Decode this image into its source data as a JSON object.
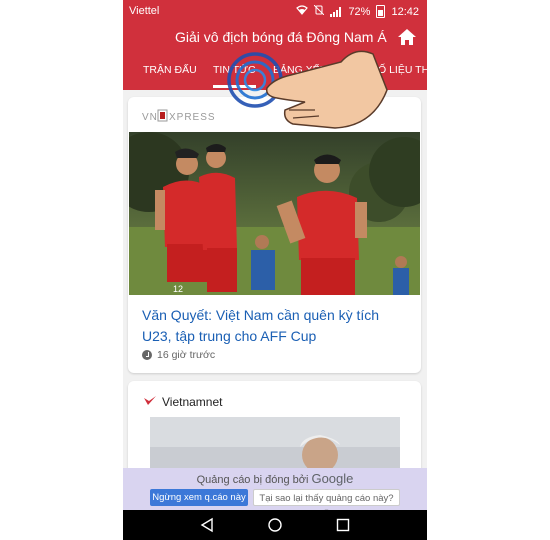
{
  "status_bar": {
    "carrier": "Viettel",
    "battery": "72%",
    "time": "12:42"
  },
  "app_bar": {
    "title": "Giải vô địch bóng đá Đông Nam Á",
    "home_icon": "home-icon"
  },
  "tabs": [
    {
      "label": "TRẬN ĐẤU",
      "active": false
    },
    {
      "label": "TIN TỨC",
      "active": true
    },
    {
      "label": "BẢNG XẾP HẠNG",
      "active": false
    },
    {
      "label": "SỐ LIỆU THỐNG KÊ",
      "active": false
    }
  ],
  "feed": {
    "card1": {
      "source": "VNEXPRESS",
      "headline": "Văn Quyết: Việt Nam cần quên kỳ tích U23, tập trung cho AFF Cup",
      "time": "16 giờ trước"
    },
    "card2": {
      "source": "Vietnamnet"
    }
  },
  "ad": {
    "label_prefix": "Quảng cáo bị đóng bởi",
    "label_brand": "Google",
    "stop_button": "Ngừng xem q.cáo này",
    "why_button": "Tại sao lại thấy quảng cáo này? ⓘ"
  },
  "colors": {
    "brand_red": "#d0303c",
    "link_blue": "#1a5fb4",
    "ad_bg": "#d9d4f0"
  }
}
